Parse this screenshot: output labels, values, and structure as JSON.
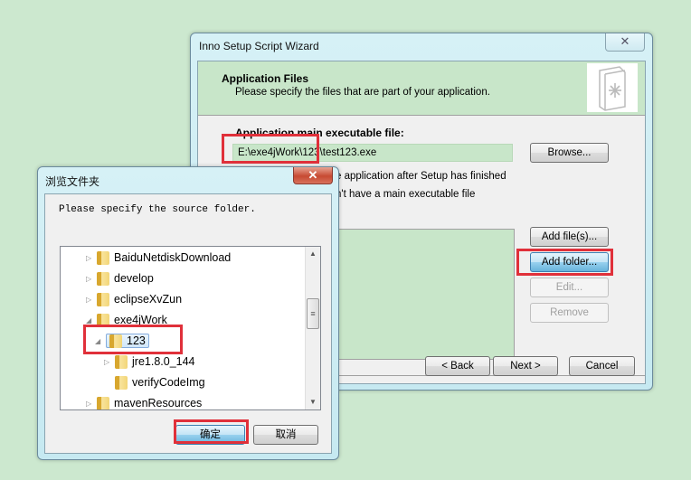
{
  "wizard": {
    "title": "Inno Setup Script Wizard",
    "close_icon": "close-icon",
    "header": {
      "title": "Application Files",
      "subtitle": "Please specify the files that are part of your application.",
      "icon": "document-star-icon"
    },
    "main_exe_label": "Application main executable file:",
    "main_exe_value": "E:\\exe4jWork\\123\\test123.exe",
    "browse_label": "Browse...",
    "option_run_after": "e application after Setup has finished",
    "option_no_main": "n't have a main executable file",
    "buttons": {
      "add_files": "Add file(s)...",
      "add_folder": "Add folder...",
      "edit": "Edit...",
      "remove": "Remove"
    },
    "nav": {
      "back": "< Back",
      "next": "Next >",
      "cancel": "Cancel"
    }
  },
  "browse_dialog": {
    "title": "浏览文件夹",
    "prompt": "Please specify the source folder.",
    "tree": [
      {
        "label": "BaiduNetdiskDownload",
        "level": 0,
        "expander": "collapsed"
      },
      {
        "label": "develop",
        "level": 0,
        "expander": "collapsed"
      },
      {
        "label": "eclipseXvZun",
        "level": 0,
        "expander": "collapsed"
      },
      {
        "label": "exe4jWork",
        "level": 0,
        "expander": "expanded"
      },
      {
        "label": "123",
        "level": 1,
        "expander": "expanded",
        "selected": true
      },
      {
        "label": "jre1.8.0_144",
        "level": 2,
        "expander": "collapsed"
      },
      {
        "label": "verifyCodeImg",
        "level": 2,
        "expander": "none"
      },
      {
        "label": "mavenResources",
        "level": 0,
        "expander": "collapsed"
      }
    ],
    "ok": "确定",
    "cancel": "取消"
  },
  "highlight_color": "#e0303a"
}
